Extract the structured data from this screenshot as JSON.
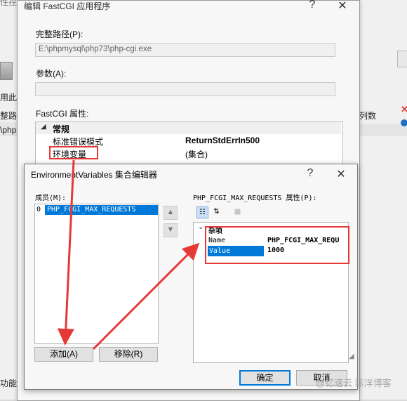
{
  "background": {
    "top_fragment": "性控制器",
    "left_items": [
      "用此",
      "整路",
      "\\php"
    ],
    "bottom_left": "功能",
    "right_column_header": "列数"
  },
  "outer_dialog": {
    "title": "编辑 FastCGI 应用程序",
    "help": "?",
    "close": "✕",
    "full_path_label": "完整路径(P):",
    "full_path_value": "E:\\phpmysql\\php73\\php-cgi.exe",
    "args_label": "参数(A):",
    "args_value": "",
    "props_label": "FastCGI 属性:",
    "category": "常规",
    "rows": [
      {
        "name": "标准错误模式",
        "value": "ReturnStdErrIn500"
      },
      {
        "name": "环境变量",
        "value": "(集合)"
      }
    ]
  },
  "inner_dialog": {
    "title": "EnvironmentVariables 集合编辑器",
    "help": "?",
    "close": "✕",
    "members_label": "成员(M):",
    "members": [
      {
        "index": "0",
        "name": "PHP_FCGI_MAX_REQUESTS"
      }
    ],
    "props_label": "PHP_FCGI_MAX_REQUESTS 属性(P):",
    "category": "杂项",
    "properties": [
      {
        "name": "Name",
        "value": "PHP_FCGI_MAX_REQU"
      },
      {
        "name": "Value",
        "value": "1000"
      }
    ],
    "add_button": "添加(A)",
    "remove_button": "移除(R)",
    "ok_button": "确定",
    "cancel_button": "取消"
  },
  "watermark": "@亿速云 陈洋博客",
  "colors": {
    "annotation": "#e53935",
    "selection": "#0078d7"
  }
}
